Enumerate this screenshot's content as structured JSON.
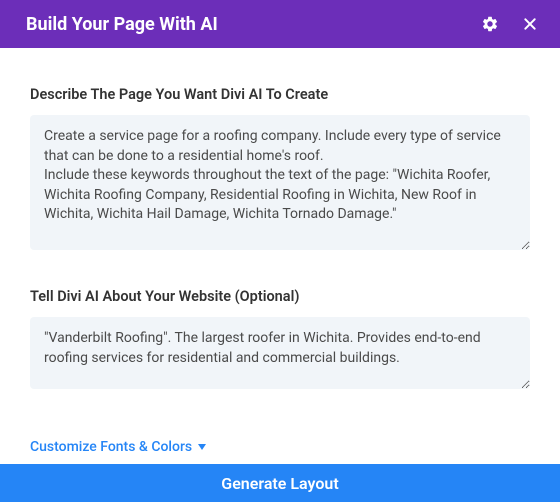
{
  "header": {
    "title": "Build Your Page With AI",
    "gear_icon": "gear-icon",
    "close_icon": "close-icon"
  },
  "fields": {
    "describe": {
      "label": "Describe The Page You Want Divi AI To Create",
      "value": "Create a service page for a roofing company. Include every type of service that can be done to a residential home's roof.\nInclude these keywords throughout the text of the page: \"Wichita Roofer, Wichita Roofing Company, Residential Roofing in Wichita, New Roof in Wichita, Wichita Hail Damage, Wichita Tornado Damage.\""
    },
    "about": {
      "label": "Tell Divi AI About Your Website (Optional)",
      "value": "\"Vanderbilt Roofing\". The largest roofer in Wichita. Provides end-to-end roofing services for residential and commercial buildings."
    }
  },
  "customize": {
    "label": "Customize Fonts & Colors"
  },
  "footer": {
    "generate_label": "Generate Layout"
  },
  "colors": {
    "header_bg": "#6c2eb9",
    "primary_blue": "#2585f6",
    "input_bg": "#f1f5f9"
  }
}
